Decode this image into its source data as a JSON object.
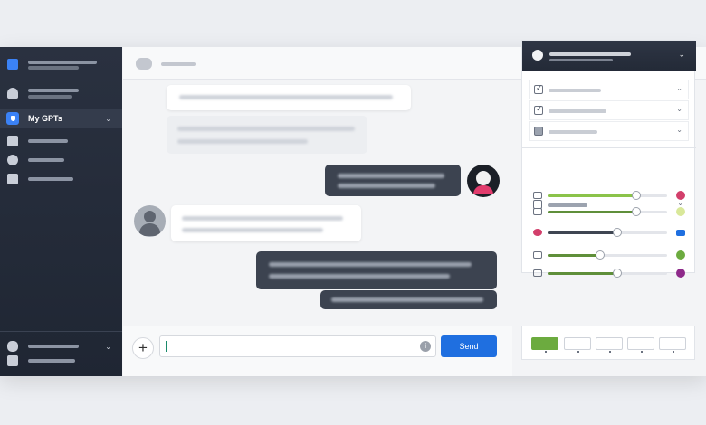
{
  "sidebar": {
    "active_label": "My GPTs"
  },
  "input": {
    "value": "",
    "placeholder": ""
  },
  "send_label": "Send",
  "colors": {
    "accent": "#1f6fe0",
    "sidebar_bg": "#252c39",
    "slider_green": "#6cab3f"
  },
  "sliders": [
    {
      "level": 0.74,
      "color": "#8bc34a",
      "swatch": "#d23f6b",
      "icon": "link-icon"
    },
    {
      "level": 0.74,
      "color": "#5f8f3a",
      "swatch": "#d9e89a",
      "icon": "card-icon"
    },
    {
      "level": 0.58,
      "color": "#3f4652",
      "swatch": "#1f6fe0",
      "icon": "heart-icon"
    },
    {
      "level": 0.44,
      "color": "#5f8f3a",
      "swatch": "#6cab3f",
      "icon": "mail-icon"
    },
    {
      "level": 0.58,
      "color": "#5f8f3a",
      "swatch": "#8e2a8a",
      "icon": "chat-icon"
    }
  ]
}
